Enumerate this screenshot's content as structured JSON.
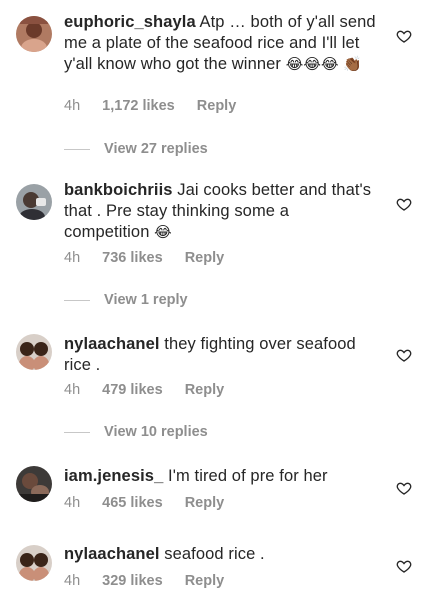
{
  "comments": [
    {
      "username": "euphoric_shayla",
      "text": "Atp … both of y'all send me a plate of the seafood rice and I'll let y'all know who got the winner",
      "emojis": "😂😂😂 👏🏾",
      "time": "4h",
      "likes": "1,172 likes",
      "reply": "Reply",
      "view_replies": "View 27 replies",
      "avatar_icon": "profile-photo"
    },
    {
      "username": "bankboichriis",
      "text": "Jai cooks better and that's that . Pre stay thinking some a competition",
      "emojis": "😂",
      "time": "4h",
      "likes": "736 likes",
      "reply": "Reply",
      "view_replies": "View 1 reply",
      "avatar_icon": "profile-photo"
    },
    {
      "username": "nylaachanel",
      "text": "they fighting over seafood rice .",
      "emojis": "",
      "time": "4h",
      "likes": "479 likes",
      "reply": "Reply",
      "view_replies": "View 10 replies",
      "avatar_icon": "profile-photo"
    },
    {
      "username": "iam.jenesis_",
      "text": "I'm tired of pre for her",
      "emojis": "",
      "time": "4h",
      "likes": "465 likes",
      "reply": "Reply",
      "view_replies": "",
      "avatar_icon": "profile-photo"
    },
    {
      "username": "nylaachanel",
      "text": "seafood rice .",
      "emojis": "",
      "time": "4h",
      "likes": "329 likes",
      "reply": "Reply",
      "view_replies": "",
      "avatar_icon": "profile-photo"
    }
  ],
  "colors": {
    "text": "#262626",
    "secondary": "#8e8e8e",
    "divider_line": "#c7c7c7"
  },
  "icons": {
    "like": "heart-outline-icon"
  }
}
